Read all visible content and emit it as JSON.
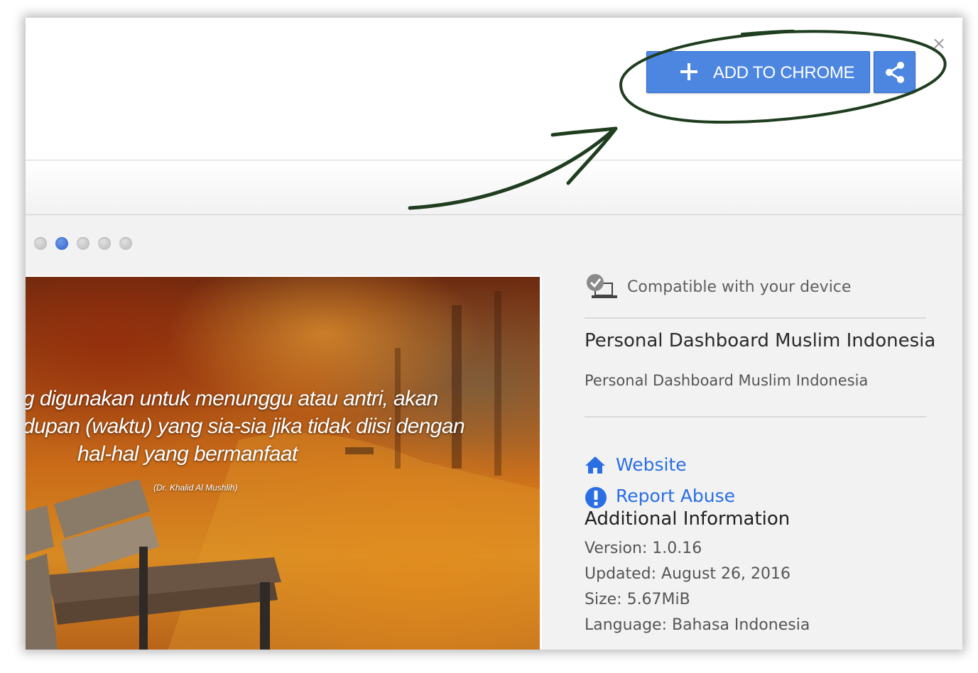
{
  "toolbar": {
    "add_button_label": "ADD TO CHROME",
    "close_glyph": "×",
    "accent_color": "#4d86e0",
    "icons": [
      "plus-icon",
      "share-icon",
      "close-icon"
    ]
  },
  "carousel": {
    "dot_count": 5,
    "active_index": 1
  },
  "screenshot": {
    "quote_lines": [
      "g digunakan untuk menunggu atau antri, akan",
      "dupan (waktu) yang sia-sia jika tidak diisi dengan",
      "hal-hal yang bermanfaat"
    ],
    "attribution": "(Dr. Khalid Al Mushlih)"
  },
  "details": {
    "compatibility": "Compatible with your device",
    "name": "Personal Dashboard Muslim Indonesia",
    "description": "Personal Dashboard Muslim Indonesia",
    "links": {
      "website": "Website",
      "report_abuse": "Report Abuse"
    },
    "additional_title": "Additional Information",
    "info": {
      "version": "Version: 1.0.16",
      "updated": "Updated: August 26, 2016",
      "size": "Size: 5.67MiB",
      "language": "Language: Bahasa Indonesia"
    }
  },
  "annotation": {
    "stroke_color": "#1f3d1f"
  }
}
